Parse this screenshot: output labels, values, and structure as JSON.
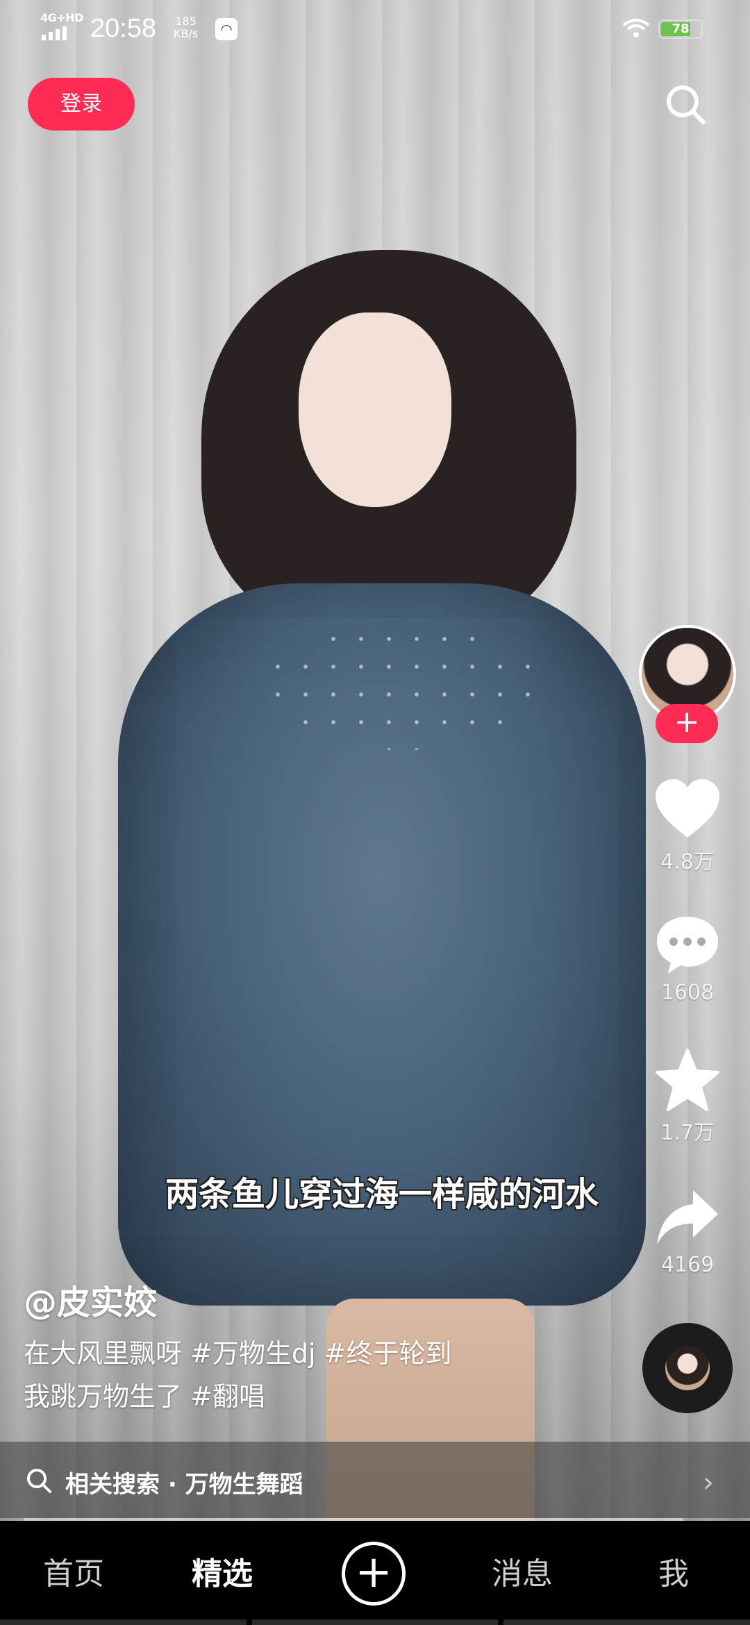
{
  "status_bar": {
    "network": "4G+HD",
    "time": "20:58",
    "speed_value": "185",
    "speed_unit": "KB/s",
    "battery": "78"
  },
  "top": {
    "login_label": "登录"
  },
  "actions": {
    "likes": "4.8万",
    "comments": "1608",
    "favorites": "1.7万",
    "shares": "4169"
  },
  "video": {
    "subtitle": "两条鱼儿穿过海一样咸的河水",
    "author": "@皮实姣",
    "description_line1": "在大风里飘呀 #万物生dj #终于轮到",
    "description_line2": "我跳万物生了 #翻唱"
  },
  "related_search": {
    "label": "相关搜索 · 万物生舞蹈"
  },
  "bottom_nav": {
    "home": "首页",
    "featured": "精选",
    "messages": "消息",
    "me": "我"
  },
  "colors": {
    "accent": "#fe2c55"
  }
}
